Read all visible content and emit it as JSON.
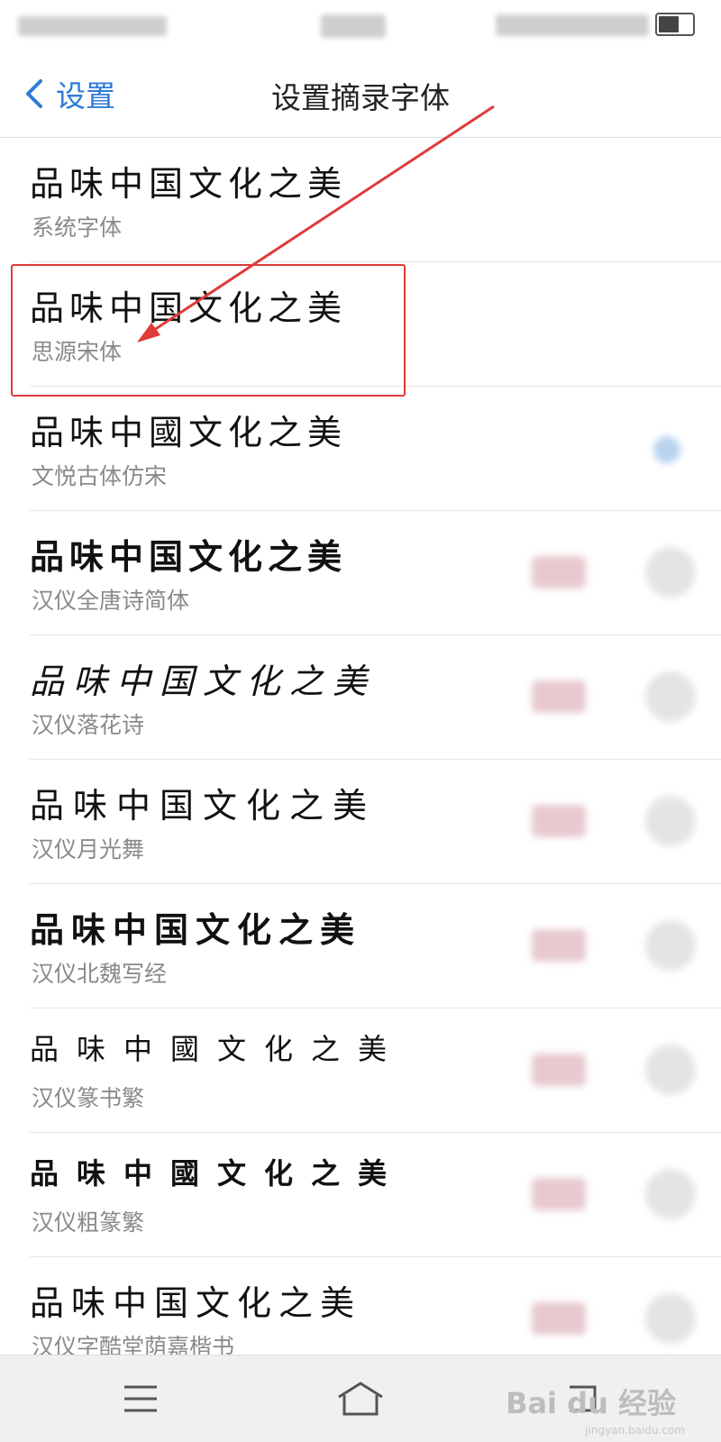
{
  "nav": {
    "back_label": "设置",
    "title": "设置摘录字体"
  },
  "fonts": [
    {
      "sample": "品味中国文化之美",
      "name": "系统字体"
    },
    {
      "sample": "品味中国文化之美",
      "name": "思源宋体"
    },
    {
      "sample": "品味中國文化之美",
      "name": "文悦古体仿宋"
    },
    {
      "sample": "品味中国文化之美",
      "name": "汉仪全唐诗简体"
    },
    {
      "sample": "品味中国文化之美",
      "name": "汉仪落花诗"
    },
    {
      "sample": "品味中国文化之美",
      "name": "汉仪月光舞"
    },
    {
      "sample": "品味中国文化之美",
      "name": "汉仪北魏写经"
    },
    {
      "sample": "品味中國文化之美",
      "name": "汉仪篆书繁"
    },
    {
      "sample": "品味中國文化之美",
      "name": "汉仪粗篆繁"
    },
    {
      "sample": "品味中国文化之美",
      "name": "汉仪字酷堂荫嘉楷书"
    }
  ],
  "watermark": {
    "text": "Bai du 经验",
    "url_text": "jingyan.baidu.com"
  },
  "colors": {
    "accent": "#2d7bd6",
    "annotation": "#e03a3a"
  },
  "icons": [
    "chevron-left-icon",
    "menu-icon",
    "home-icon",
    "back-nav-icon",
    "download-icon"
  ]
}
